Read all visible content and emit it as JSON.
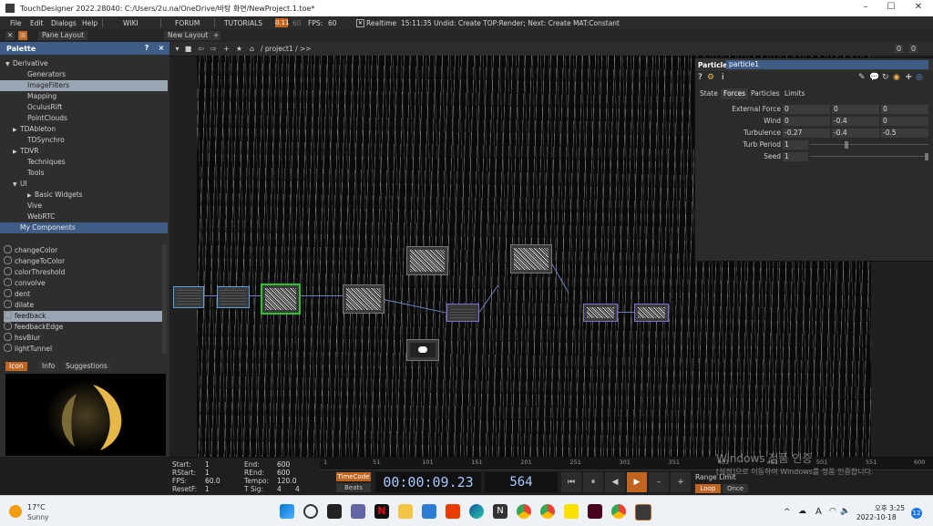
{
  "window": {
    "title": "TouchDesigner 2022.28040: C:/Users/2u.na/OneDrive/바탕 화면/NewProject.1.toe*"
  },
  "menu": {
    "items": [
      "File",
      "Edit",
      "Dialogs",
      "Help"
    ],
    "wiki": "WIKI",
    "forum": "FORUM",
    "tutorials": "TUTORIALS",
    "perf_value": "0.11",
    "fps_dim": "60",
    "fps_label": "FPS:",
    "fps_value": "60",
    "realtime": "Realtime",
    "status": "15:11:35 Undid: Create TOP:Render; Next: Create MAT:Constant"
  },
  "panebar": {
    "pane_layout": "Pane Layout",
    "new_layout": "New Layout",
    "add": "+"
  },
  "palette": {
    "title": "Palette",
    "help": "?",
    "close": "×",
    "tree": [
      {
        "label": "Derivative",
        "indent": 0,
        "arrow": "▼",
        "state": ""
      },
      {
        "label": "Generators",
        "indent": 2,
        "arrow": "",
        "state": ""
      },
      {
        "label": "ImageFilters",
        "indent": 2,
        "arrow": "",
        "state": "sel"
      },
      {
        "label": "Mapping",
        "indent": 2,
        "arrow": "",
        "state": ""
      },
      {
        "label": "OculusRift",
        "indent": 2,
        "arrow": "",
        "state": ""
      },
      {
        "label": "PointClouds",
        "indent": 2,
        "arrow": "",
        "state": ""
      },
      {
        "label": "TDAbleton",
        "indent": 1,
        "arrow": "▶",
        "state": ""
      },
      {
        "label": "TDSynchro",
        "indent": 2,
        "arrow": "",
        "state": ""
      },
      {
        "label": "TDVR",
        "indent": 1,
        "arrow": "▶",
        "state": ""
      },
      {
        "label": "Techniques",
        "indent": 2,
        "arrow": "",
        "state": ""
      },
      {
        "label": "Tools",
        "indent": 2,
        "arrow": "",
        "state": ""
      },
      {
        "label": "UI",
        "indent": 1,
        "arrow": "▼",
        "state": ""
      },
      {
        "label": "Basic Widgets",
        "indent": 3,
        "arrow": "▶",
        "state": ""
      },
      {
        "label": "Vive",
        "indent": 2,
        "arrow": "",
        "state": ""
      },
      {
        "label": "WebRTC",
        "indent": 2,
        "arrow": "",
        "state": ""
      },
      {
        "label": "My Components",
        "indent": 1,
        "arrow": "",
        "state": "mycomp"
      }
    ],
    "list": [
      {
        "label": "changeColor",
        "state": ""
      },
      {
        "label": "changeToColor",
        "state": ""
      },
      {
        "label": "colorThreshold",
        "state": ""
      },
      {
        "label": "convolve",
        "state": ""
      },
      {
        "label": "dent",
        "state": ""
      },
      {
        "label": "dilate",
        "state": ""
      },
      {
        "label": "feedback",
        "state": "sel"
      },
      {
        "label": "feedbackEdge",
        "state": ""
      },
      {
        "label": "hsvBlur",
        "state": ""
      },
      {
        "label": "lightTunnel",
        "state": ""
      }
    ],
    "info_tabs": [
      "Icon",
      "Info",
      "Suggestions"
    ]
  },
  "network": {
    "breadcrumb": "/ project1 / >>",
    "right_btns": [
      "0",
      "0"
    ]
  },
  "params": {
    "type_label": "Particle",
    "node_name": "particle1",
    "tabs": [
      "State",
      "Forces",
      "Particles",
      "Limits"
    ],
    "active_tab": 1,
    "rows": [
      {
        "label": "External Force",
        "values": [
          "0",
          "0",
          "0"
        ],
        "slider": false
      },
      {
        "label": "Wind",
        "values": [
          "0",
          "-0.4",
          "0"
        ],
        "slider": false
      },
      {
        "label": "Turbulence",
        "values": [
          "-0.27",
          "-0.4",
          "-0.5"
        ],
        "slider": false
      },
      {
        "label": "Turb Period",
        "values": [
          "1"
        ],
        "slider": true,
        "level": 0.3
      },
      {
        "label": "Seed",
        "values": [
          "1"
        ],
        "slider": true,
        "level": 1.0
      }
    ]
  },
  "timeline": {
    "start_label": "Start:",
    "start": "1",
    "end_label": "End:",
    "end": "600",
    "rstart_label": "RStart:",
    "rstart": "1",
    "rend_label": "REnd:",
    "rend": "600",
    "fps_label": "FPS:",
    "fps": "60.0",
    "tempo_label": "Tempo:",
    "tempo": "120.0",
    "resetf_label": "ResetF:",
    "resetf": "1",
    "tsig_label": "T Sig:",
    "tsig1": "4",
    "tsig2": "4",
    "ticks": [
      "1",
      "51",
      "101",
      "151",
      "201",
      "251",
      "301",
      "351",
      "401",
      "451",
      "501",
      "551",
      "600"
    ],
    "timecode_btn": "TimeCode",
    "beats_btn": "Beats",
    "timecode": "00:00:09.23",
    "frame": "564",
    "range_limit": "Range Limit",
    "loop": "Loop",
    "once": "Once",
    "watermark": "Windows 정품 인증",
    "watermark_sub": "[설정]으로 이동하여 Windows를 정품 인증합니다."
  },
  "taskbar": {
    "temp": "17°C",
    "weather": "Sunny",
    "ime": "A",
    "time": "오후 3:25",
    "date": "2022-10-18",
    "notifications": "12"
  }
}
